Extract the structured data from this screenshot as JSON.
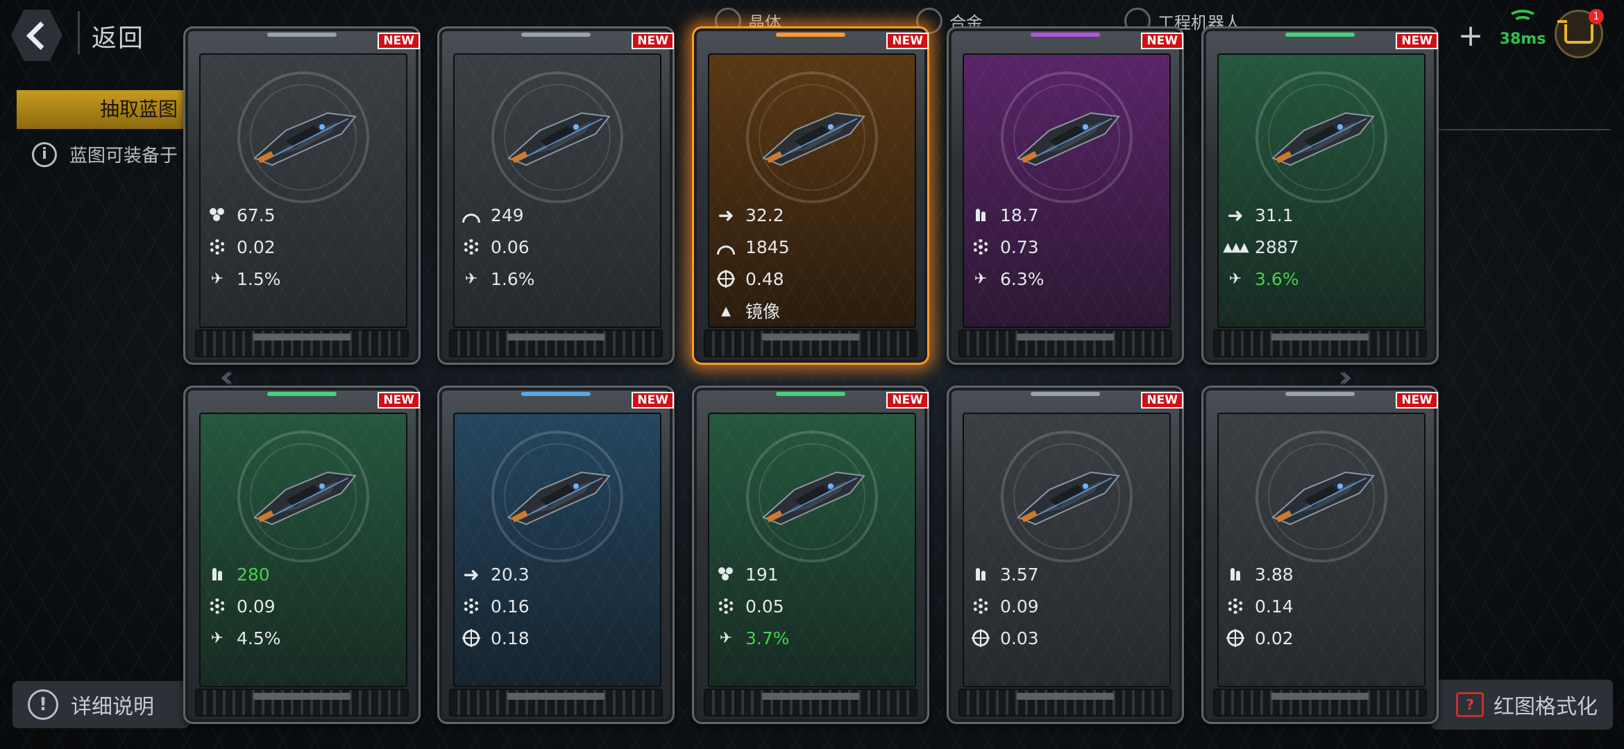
{
  "header": {
    "back_label": "返回",
    "resources": [
      {
        "label": "晶体"
      },
      {
        "label": "合金"
      },
      {
        "label": "工程机器人"
      }
    ],
    "network_latency": "38ms",
    "cart_badge": "1"
  },
  "tabs": {
    "active_label": "抽取蓝图"
  },
  "hint_text": "蓝图可装备于",
  "footer": {
    "detail_label": "详细说明",
    "format_label": "红图格式化"
  },
  "colors": {
    "accent_orange": "#ff9a2a",
    "new_badge": "#d10e14",
    "stat_green": "#45d24f",
    "panel_gray": "#2b2f33",
    "panel_purple": "#4a1f55",
    "panel_green": "#1e4a34",
    "panel_blue": "#1f3a50",
    "panel_orange": "#4a3016"
  },
  "cards": [
    {
      "badge": "NEW",
      "tier": "gray",
      "selected": false,
      "stats": [
        {
          "icon": "cluster-icon",
          "value": "67.5",
          "green": false
        },
        {
          "icon": "gear-icon",
          "value": "0.02",
          "green": false
        },
        {
          "icon": "rocket-icon",
          "value": "1.5%",
          "green": false
        }
      ]
    },
    {
      "badge": "NEW",
      "tier": "gray",
      "selected": false,
      "stats": [
        {
          "icon": "dome-icon",
          "value": "249",
          "green": false
        },
        {
          "icon": "gear-icon",
          "value": "0.06",
          "green": false
        },
        {
          "icon": "rocket-icon",
          "value": "1.6%",
          "green": false
        }
      ]
    },
    {
      "badge": "NEW",
      "tier": "orange",
      "selected": true,
      "stats": [
        {
          "icon": "arrow-icon",
          "value": "32.2",
          "green": false
        },
        {
          "icon": "dome-icon",
          "value": "1845",
          "green": false
        },
        {
          "icon": "crosshair-icon",
          "value": "0.48",
          "green": false
        },
        {
          "icon": "mirror-icon",
          "value": "镜像",
          "green": false
        }
      ]
    },
    {
      "badge": "NEW",
      "tier": "purple",
      "selected": false,
      "stats": [
        {
          "icon": "ammo-icon",
          "value": "18.7",
          "green": false
        },
        {
          "icon": "gear-icon",
          "value": "0.73",
          "green": false
        },
        {
          "icon": "rocket-icon",
          "value": "6.3%",
          "green": false
        }
      ]
    },
    {
      "badge": "NEW",
      "tier": "green",
      "selected": false,
      "stats": [
        {
          "icon": "arrow-icon",
          "value": "31.1",
          "green": false
        },
        {
          "icon": "fleet-icon",
          "value": "2887",
          "green": false
        },
        {
          "icon": "rocket-icon",
          "value": "3.6%",
          "green": true
        }
      ]
    },
    {
      "badge": "NEW",
      "tier": "green",
      "selected": false,
      "stats": [
        {
          "icon": "ammo-icon",
          "value": "280",
          "green": true
        },
        {
          "icon": "gear-icon",
          "value": "0.09",
          "green": false
        },
        {
          "icon": "rocket-icon",
          "value": "4.5%",
          "green": false
        }
      ]
    },
    {
      "badge": "NEW",
      "tier": "blue",
      "selected": false,
      "stats": [
        {
          "icon": "arrow-icon",
          "value": "20.3",
          "green": false
        },
        {
          "icon": "gear-icon",
          "value": "0.16",
          "green": false
        },
        {
          "icon": "crosshair-icon",
          "value": "0.18",
          "green": false
        }
      ]
    },
    {
      "badge": "NEW",
      "tier": "green",
      "selected": false,
      "stats": [
        {
          "icon": "cluster-icon",
          "value": "191",
          "green": false
        },
        {
          "icon": "gear-icon",
          "value": "0.05",
          "green": false
        },
        {
          "icon": "rocket-icon",
          "value": "3.7%",
          "green": true
        }
      ]
    },
    {
      "badge": "NEW",
      "tier": "gray",
      "selected": false,
      "stats": [
        {
          "icon": "ammo-icon",
          "value": "3.57",
          "green": false
        },
        {
          "icon": "gear-icon",
          "value": "0.09",
          "green": false
        },
        {
          "icon": "crosshair-icon",
          "value": "0.03",
          "green": false
        }
      ]
    },
    {
      "badge": "NEW",
      "tier": "gray",
      "selected": false,
      "stats": [
        {
          "icon": "ammo-icon",
          "value": "3.88",
          "green": false
        },
        {
          "icon": "gear-icon",
          "value": "0.14",
          "green": false
        },
        {
          "icon": "crosshair-icon",
          "value": "0.02",
          "green": false
        }
      ]
    }
  ]
}
